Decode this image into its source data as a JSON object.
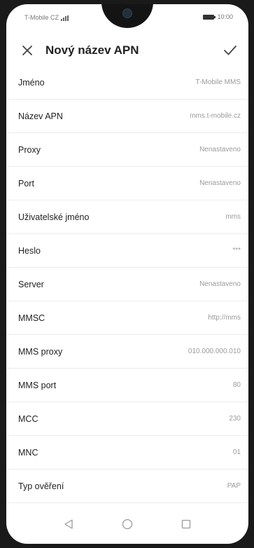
{
  "status_bar": {
    "carrier": "T-Mobile CZ",
    "time": "10:00"
  },
  "header": {
    "close_icon": "close-icon",
    "title": "Nový název APN",
    "save_icon": "check-icon"
  },
  "fields": [
    {
      "label": "Jméno",
      "value": "T-Mobile MMS"
    },
    {
      "label": "Název APN",
      "value": "mms.t-mobile.cz"
    },
    {
      "label": "Proxy",
      "value": "Nenastaveno"
    },
    {
      "label": "Port",
      "value": "Nenastaveno"
    },
    {
      "label": "Uživatelské jméno",
      "value": "mms"
    },
    {
      "label": "Heslo",
      "value": "***"
    },
    {
      "label": "Server",
      "value": "Nenastaveno"
    },
    {
      "label": "MMSC",
      "value": "http://mms"
    },
    {
      "label": "MMS proxy",
      "value": "010.000.000.010"
    },
    {
      "label": "MMS port",
      "value": "80"
    },
    {
      "label": "MCC",
      "value": "230"
    },
    {
      "label": "MNC",
      "value": "01"
    },
    {
      "label": "Typ ověření",
      "value": "PAP"
    }
  ],
  "nav_bar": {
    "icons": [
      "back-icon",
      "home-icon",
      "recents-icon"
    ]
  }
}
